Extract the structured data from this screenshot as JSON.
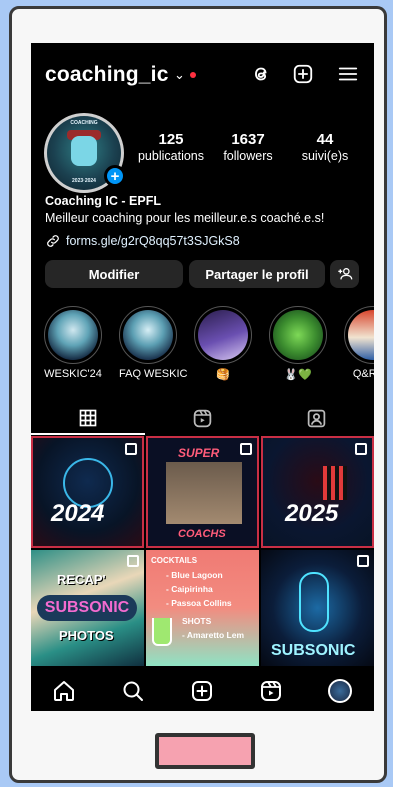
{
  "header": {
    "username": "coaching_ic",
    "chevron": "chevron-down-icon",
    "icons": [
      "threads-icon",
      "create-icon",
      "menu-icon"
    ]
  },
  "profile": {
    "stats": [
      {
        "value": "125",
        "label": "publications"
      },
      {
        "value": "1637",
        "label": "followers"
      },
      {
        "value": "44",
        "label": "suivi(e)s"
      }
    ],
    "name": "Coaching IC - EPFL",
    "bio": "Meilleur coaching pour les meilleur.e.s coaché.e.s!",
    "link": "forms.gle/g2rQ8qq57t3SJGkS8"
  },
  "buttons": {
    "edit": "Modifier",
    "share": "Partager le profil",
    "add_person": "+⋆"
  },
  "highlights": [
    {
      "label": "WESKIC'24"
    },
    {
      "label": "FAQ WESKIC"
    },
    {
      "label": "🥞"
    },
    {
      "label": "🐰💚"
    },
    {
      "label": "Q&R: W"
    }
  ],
  "tabs": [
    "grid-icon",
    "reels-icon",
    "tagged-icon"
  ],
  "posts": [
    {
      "text": "2024"
    },
    {
      "text_top": "SUPER",
      "text_bottom": "COACHS"
    },
    {
      "text": "2025"
    },
    {
      "text_top": "RECAP'",
      "text_mid": "SUBSONIC",
      "text_bottom": "PHOTOS"
    },
    {
      "text_top": "COCKTAILS",
      "line1": "- Blue Lagoon",
      "line2": "- Caipirinha",
      "line3": "- Passoa Collins",
      "line4": "SHOTS",
      "line5": "- Amaretto Lem"
    },
    {
      "text": "SUBSONIC"
    }
  ],
  "nav": [
    "home-icon",
    "search-icon",
    "create-icon",
    "reels-icon",
    "profile-avatar"
  ],
  "colors": {
    "accent": "#0095f6",
    "notification": "#ff3040",
    "button_bg": "#262626",
    "home_button": "#f6a2b0"
  }
}
